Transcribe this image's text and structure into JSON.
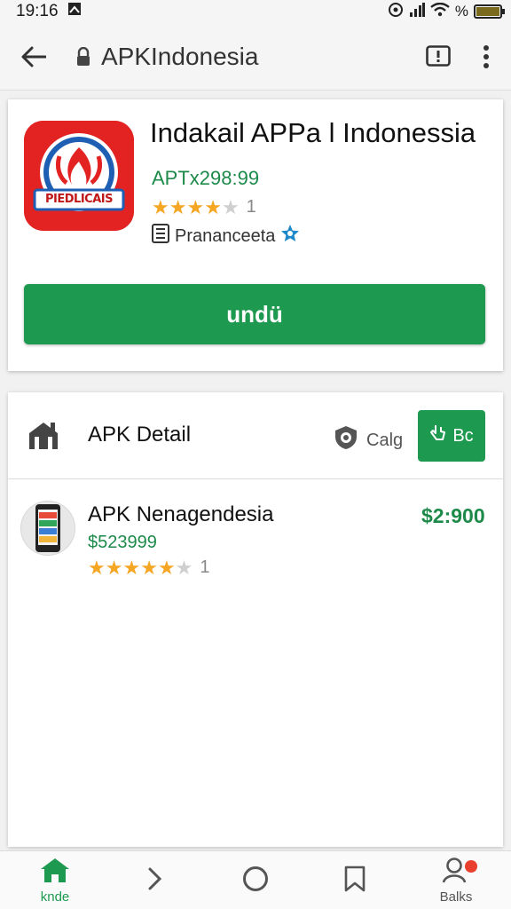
{
  "status_bar": {
    "time": "19:16",
    "battery_text": "%"
  },
  "address_bar": {
    "url": "APKIndonesia"
  },
  "app": {
    "icon_text": "PIEDLICAIS",
    "title": "Indakail APPa l Indonessia",
    "price": "APTx298:99",
    "rating_stars": 4,
    "rating_max": 5,
    "rating_count": "1",
    "developer": "Prananceeta",
    "install_label": "undü"
  },
  "detail": {
    "title": "APK Detail",
    "category_label": "Calg",
    "action_label": "Bc",
    "items": [
      {
        "name": "APK Nenagendesia",
        "subtitle": "$523999",
        "price": "$2:900",
        "rating_stars": 5,
        "rating_count": "1"
      }
    ]
  },
  "bottom_nav": {
    "items": [
      {
        "label": "knde",
        "icon": "home-icon",
        "active": true
      },
      {
        "label": "",
        "icon": "chevron-right-icon"
      },
      {
        "label": "",
        "icon": "circle-icon"
      },
      {
        "label": "",
        "icon": "bookmark-icon"
      },
      {
        "label": "Balks",
        "icon": "user-icon",
        "badge": true
      }
    ]
  },
  "colors": {
    "accent": "#1e9a50",
    "star": "#f5a623",
    "badge": "#e8402c",
    "app_icon": "#e32222"
  }
}
